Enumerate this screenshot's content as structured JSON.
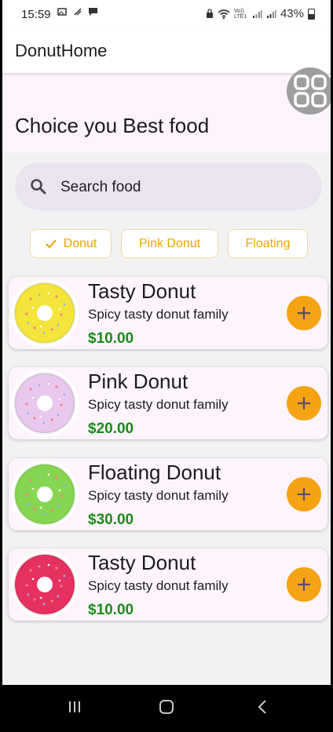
{
  "status_bar": {
    "time": "15:59",
    "left_icons": [
      "image-gallery-icon",
      "signal-arrows-icon",
      "chat-icon"
    ],
    "right_icons": [
      "lock-icon",
      "wifi-icon",
      "volte-icon",
      "signal-icon",
      "signal-icon"
    ],
    "volte_label": "Vo)) LTE1",
    "battery": "43%"
  },
  "app_bar": {
    "title": "DonutHome"
  },
  "header": {
    "title": "Choice you Best food"
  },
  "search": {
    "placeholder": "Search food",
    "icon": "search-icon"
  },
  "chips": [
    {
      "label": "Donut",
      "selected": true
    },
    {
      "label": "Pink Donut",
      "selected": false
    },
    {
      "label": "Floating",
      "selected": false
    }
  ],
  "items": [
    {
      "name": "Tasty Donut",
      "description": "Spicy tasty donut family",
      "price": "$10.00",
      "image": "yellow-donut",
      "color": "#f5e53a"
    },
    {
      "name": "Pink Donut",
      "description": "Spicy tasty donut family",
      "price": "$20.00",
      "image": "pink-donut",
      "color": "#e8c8ec"
    },
    {
      "name": "Floating Donut",
      "description": "Spicy tasty donut family",
      "price": "$30.00",
      "image": "green-donut",
      "color": "#86d651"
    },
    {
      "name": "Tasty Donut",
      "description": "Spicy tasty donut family",
      "price": "$10.00",
      "image": "red-donut",
      "color": "#e6305e"
    }
  ],
  "colors": {
    "accent": "#f6a313",
    "price": "#1a8a1a",
    "card_bg": "#fdf5fb",
    "search_bg": "#ebe3f0"
  }
}
